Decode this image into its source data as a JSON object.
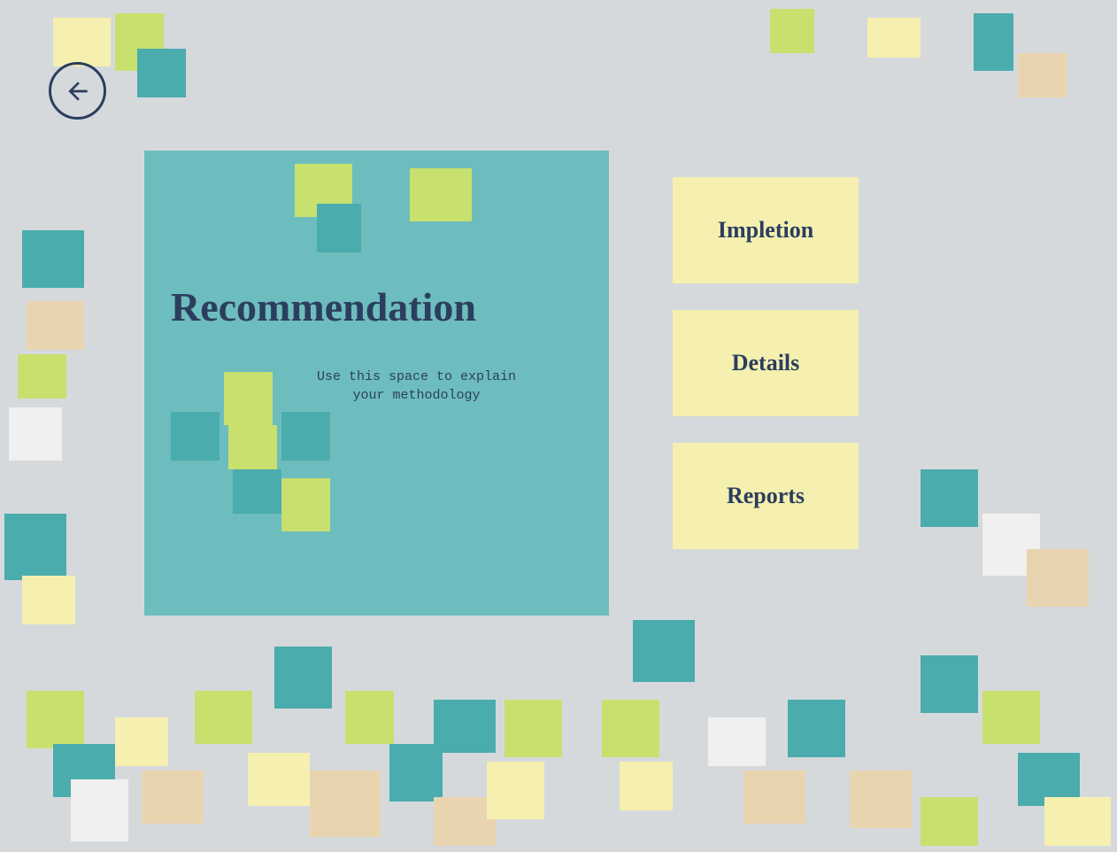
{
  "background_color": "#d6d9dc",
  "back_button": {
    "label": "back",
    "aria": "Go back"
  },
  "main_card": {
    "title": "Recommendation",
    "subtitle_line1": "Use this space to explain",
    "subtitle_line2": "your methodology",
    "background_color": "#6dbdbe"
  },
  "nav_buttons": [
    {
      "id": "impletion",
      "label": "Impletion"
    },
    {
      "id": "details",
      "label": "Details"
    },
    {
      "id": "reports",
      "label": "Reports"
    }
  ],
  "decorative_squares": {
    "colors": {
      "teal": "#4aacad",
      "light_green": "#c8e06e",
      "yellow": "#f5f0b0",
      "peach": "#e8d5b0",
      "white": "#f0f0f0"
    }
  }
}
